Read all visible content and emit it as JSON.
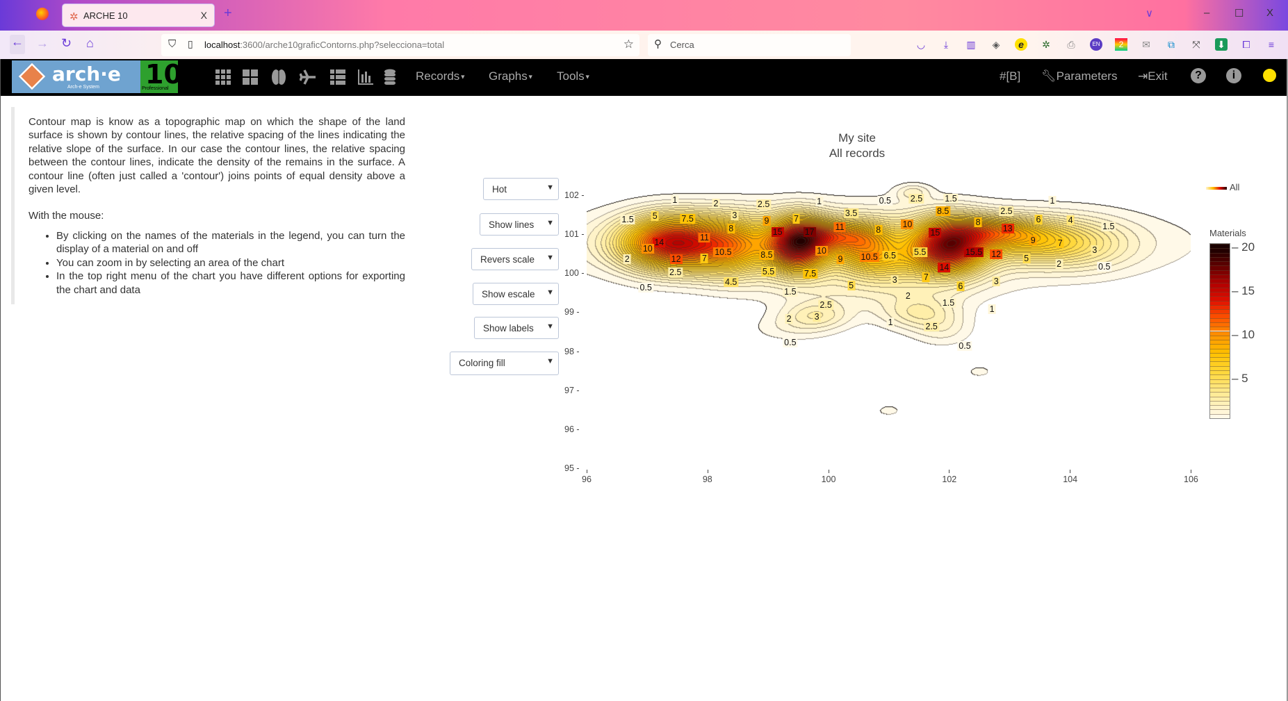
{
  "browser": {
    "tab_title": "ARCHE 10",
    "tab_close": "X",
    "new_tab": "+",
    "url_host": "localhost",
    "url_path": ":3600/arche10graficContorns.php?selecciona=total",
    "search_placeholder": "Cerca",
    "window_controls": {
      "minimize": "–",
      "maximize": "☐",
      "close": "X",
      "list_tabs": "∨"
    }
  },
  "navbar": {
    "logo_text": "arch·e",
    "logo_sub": "Arch-e System",
    "version": "10",
    "edition": "Professional",
    "icons": [
      "grid-icon",
      "windows-icon",
      "brain-icon",
      "plane-icon",
      "list-icon",
      "bar-chart-icon",
      "database-icon"
    ],
    "menus": [
      {
        "label": "Records"
      },
      {
        "label": "Graphs"
      },
      {
        "label": "Tools"
      }
    ],
    "right": {
      "hash": "#[B]",
      "parameters": "Parameters",
      "exit": "Exit"
    }
  },
  "description": {
    "paragraph": "Contour map is know as a topographic map on which the shape of the land surface is shown by contour lines, the relative spacing of the lines indicating the relative slope of the surface. In our case the contour lines, the relative spacing between the contour lines, indicate the density of the remains in the surface. A contour line (often just called a 'contour') joins points of equal density above a given level.",
    "mouse_heading": "With the mouse:",
    "bullets": [
      "By clicking on the names of the materials in the legend, you can turn the display of a material on and off",
      "You can zoom in by selecting an area of the chart",
      "In the top right menu of the chart you have different options for exporting the chart and data"
    ]
  },
  "controls": {
    "colorscale": "Hot",
    "lines": "Show lines",
    "scale": "Revers scale",
    "escale": "Show escale",
    "labels": "Show labels",
    "coloring": "Coloring fill"
  },
  "chart_data": {
    "type": "contour",
    "title": "My site",
    "subtitle": "All records",
    "xlim": [
      96,
      106
    ],
    "ylim": [
      95,
      102
    ],
    "x_ticks": [
      "96",
      "98",
      "100",
      "102",
      "104",
      "106"
    ],
    "y_ticks": [
      "95",
      "96",
      "97",
      "98",
      "99",
      "100",
      "101",
      "102"
    ],
    "grid": false,
    "legend": {
      "position": "top-right",
      "entries": [
        "All"
      ]
    },
    "colorbar": {
      "title": "Materials",
      "range": [
        0.5,
        20.5
      ],
      "ticks": [
        "5",
        "10",
        "15",
        "20"
      ],
      "step": 0.5
    },
    "colorscale": [
      "#fffaf0",
      "#fff2c0",
      "#ffe680",
      "#ffd633",
      "#ffc000",
      "#ff9500",
      "#ff5500",
      "#e01000",
      "#b00000",
      "#600000",
      "#1a0000"
    ],
    "contour_labels": [
      {
        "x": 97.46,
        "y": 101.9,
        "t": "1"
      },
      {
        "x": 98.14,
        "y": 101.81,
        "t": "2"
      },
      {
        "x": 98.93,
        "y": 101.79,
        "t": "2.5"
      },
      {
        "x": 99.85,
        "y": 101.86,
        "t": "1"
      },
      {
        "x": 100.94,
        "y": 101.88,
        "t": "0.5"
      },
      {
        "x": 101.46,
        "y": 101.92,
        "t": "2.5"
      },
      {
        "x": 102.03,
        "y": 101.92,
        "t": "1.5"
      },
      {
        "x": 103.71,
        "y": 101.88,
        "t": "1"
      },
      {
        "x": 96.68,
        "y": 101.39,
        "t": "1.5"
      },
      {
        "x": 97.13,
        "y": 101.48,
        "t": "5"
      },
      {
        "x": 97.67,
        "y": 101.41,
        "t": "7.5"
      },
      {
        "x": 98.45,
        "y": 101.5,
        "t": "3"
      },
      {
        "x": 98.98,
        "y": 101.35,
        "t": "9"
      },
      {
        "x": 99.47,
        "y": 101.41,
        "t": "7"
      },
      {
        "x": 100.38,
        "y": 101.56,
        "t": "3.5"
      },
      {
        "x": 100.19,
        "y": 101.2,
        "t": "11"
      },
      {
        "x": 99.69,
        "y": 101.08,
        "t": "17"
      },
      {
        "x": 101.9,
        "y": 101.6,
        "t": "8.5"
      },
      {
        "x": 102.95,
        "y": 101.6,
        "t": "2.5"
      },
      {
        "x": 102.48,
        "y": 101.33,
        "t": "8"
      },
      {
        "x": 103.48,
        "y": 101.39,
        "t": "6"
      },
      {
        "x": 104.01,
        "y": 101.37,
        "t": "4"
      },
      {
        "x": 104.64,
        "y": 101.22,
        "t": "1.5"
      },
      {
        "x": 102.97,
        "y": 101.16,
        "t": "13"
      },
      {
        "x": 98.39,
        "y": 101.16,
        "t": "8"
      },
      {
        "x": 100.83,
        "y": 101.12,
        "t": "8"
      },
      {
        "x": 101.31,
        "y": 101.27,
        "t": "10"
      },
      {
        "x": 99.16,
        "y": 101.08,
        "t": "15"
      },
      {
        "x": 101.77,
        "y": 101.05,
        "t": "15"
      },
      {
        "x": 97.2,
        "y": 100.8,
        "t": "14"
      },
      {
        "x": 97.95,
        "y": 100.93,
        "t": "11"
      },
      {
        "x": 97.01,
        "y": 100.65,
        "t": "10"
      },
      {
        "x": 98.26,
        "y": 100.55,
        "t": "10.5"
      },
      {
        "x": 98.98,
        "y": 100.49,
        "t": "8.5"
      },
      {
        "x": 99.89,
        "y": 100.59,
        "t": "10"
      },
      {
        "x": 100.2,
        "y": 100.38,
        "t": "9"
      },
      {
        "x": 100.68,
        "y": 100.44,
        "t": "10.5"
      },
      {
        "x": 101.02,
        "y": 100.46,
        "t": "6.5"
      },
      {
        "x": 101.52,
        "y": 100.55,
        "t": "5.5"
      },
      {
        "x": 102.41,
        "y": 100.55,
        "t": "15.5"
      },
      {
        "x": 102.78,
        "y": 100.51,
        "t": "12"
      },
      {
        "x": 103.39,
        "y": 100.86,
        "t": "9"
      },
      {
        "x": 103.84,
        "y": 100.78,
        "t": "7"
      },
      {
        "x": 104.41,
        "y": 100.61,
        "t": "3"
      },
      {
        "x": 96.67,
        "y": 100.38,
        "t": "2"
      },
      {
        "x": 97.48,
        "y": 100.38,
        "t": "12"
      },
      {
        "x": 97.95,
        "y": 100.4,
        "t": "7"
      },
      {
        "x": 101.92,
        "y": 100.17,
        "t": "14"
      },
      {
        "x": 103.28,
        "y": 100.4,
        "t": "5"
      },
      {
        "x": 103.82,
        "y": 100.25,
        "t": "2"
      },
      {
        "x": 104.57,
        "y": 100.19,
        "t": "0.5"
      },
      {
        "x": 97.47,
        "y": 100.04,
        "t": "2.5"
      },
      {
        "x": 99.01,
        "y": 100.06,
        "t": "5.5"
      },
      {
        "x": 99.7,
        "y": 100.0,
        "t": "7.5"
      },
      {
        "x": 101.1,
        "y": 99.85,
        "t": "3"
      },
      {
        "x": 101.62,
        "y": 99.92,
        "t": "7"
      },
      {
        "x": 102.19,
        "y": 99.68,
        "t": "6"
      },
      {
        "x": 102.78,
        "y": 99.81,
        "t": "3"
      },
      {
        "x": 98.39,
        "y": 99.79,
        "t": "4.5"
      },
      {
        "x": 100.38,
        "y": 99.7,
        "t": "5"
      },
      {
        "x": 96.98,
        "y": 99.64,
        "t": "0.5"
      },
      {
        "x": 99.37,
        "y": 99.54,
        "t": "1.5"
      },
      {
        "x": 101.32,
        "y": 99.43,
        "t": "2"
      },
      {
        "x": 101.99,
        "y": 99.26,
        "t": "1.5"
      },
      {
        "x": 102.71,
        "y": 99.09,
        "t": "1"
      },
      {
        "x": 99.96,
        "y": 99.2,
        "t": "2.5"
      },
      {
        "x": 99.81,
        "y": 98.9,
        "t": "3"
      },
      {
        "x": 99.35,
        "y": 98.84,
        "t": "2"
      },
      {
        "x": 101.03,
        "y": 98.76,
        "t": "1"
      },
      {
        "x": 101.71,
        "y": 98.65,
        "t": "2.5"
      },
      {
        "x": 99.37,
        "y": 98.25,
        "t": "0.5"
      },
      {
        "x": 102.26,
        "y": 98.16,
        "t": "0.5"
      }
    ]
  }
}
